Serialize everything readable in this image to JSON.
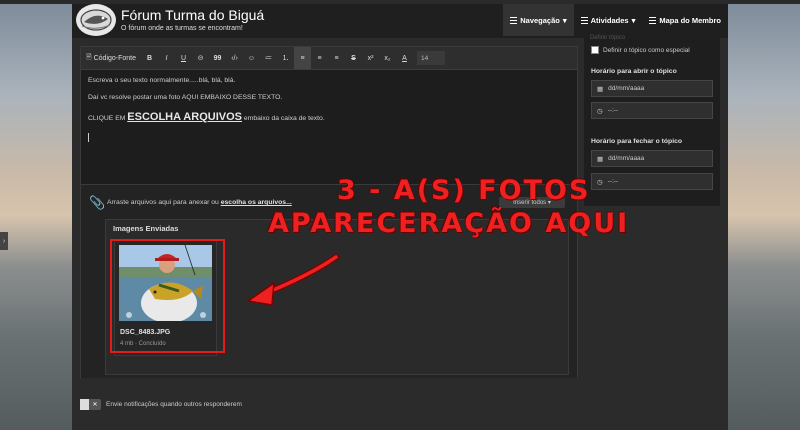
{
  "header": {
    "site_title": "Fórum Turma do Biguá",
    "site_subtitle": "O fórum onde as turmas se encontram!",
    "nav": [
      {
        "label": "Navegação",
        "caret": "▾"
      },
      {
        "label": "Atividades",
        "caret": "▾"
      },
      {
        "label": "Mapa do Membro",
        "caret": ""
      }
    ]
  },
  "toolbar": {
    "source_label": "Código-Fonte",
    "bold": "B",
    "italic": "I",
    "underline": "U",
    "link": "⊝",
    "quote": "99",
    "code": "‹/›",
    "emoji": "☺",
    "bullets": "≔",
    "numbers": "⒈",
    "align_left": "≡",
    "align_center": "≡",
    "align_right": "≡",
    "strike": "S",
    "superscript": "x²",
    "subscript": "x₂",
    "color": "A",
    "font_size": "14"
  },
  "editor": {
    "line1": "Escreva o seu texto normalmente.....blá, blá, blá.",
    "line2": "Daí vc resolve postar uma foto AQUI EMBAIXO DESSE TEXTO.",
    "line3_pre": "CLIQUE EM ",
    "line3_big": "ESCOLHA ARQUIVOS",
    "line3_post": " embaixo da caixa de texto."
  },
  "attachments": {
    "drop_text": "Arraste arquivos aqui para anexar ou ",
    "choose_link": "escolha os arquivos...",
    "insert_button": "Inserir todos ▾",
    "section_title": "Imagens Enviadas",
    "file": {
      "name": "DSC_8483.JPG",
      "meta": "4 mb · Concluído"
    }
  },
  "sidebar": {
    "faded_title": "Definir tópico",
    "special_label": "Definir o tópico como especial",
    "open_label": "Horário para abrir o tópico",
    "close_label": "Horário para fechar o tópico",
    "date_placeholder": "dd/mm/aaaa",
    "time_placeholder": "--:--"
  },
  "notify": {
    "toggle_label": "✕",
    "text": "Envie notificações quando outros responderem"
  },
  "overlay": {
    "line1": "3 - A(S) FOTOS",
    "line2": "APARECERAÇÃO AQUI",
    "color": "#ee2020"
  }
}
